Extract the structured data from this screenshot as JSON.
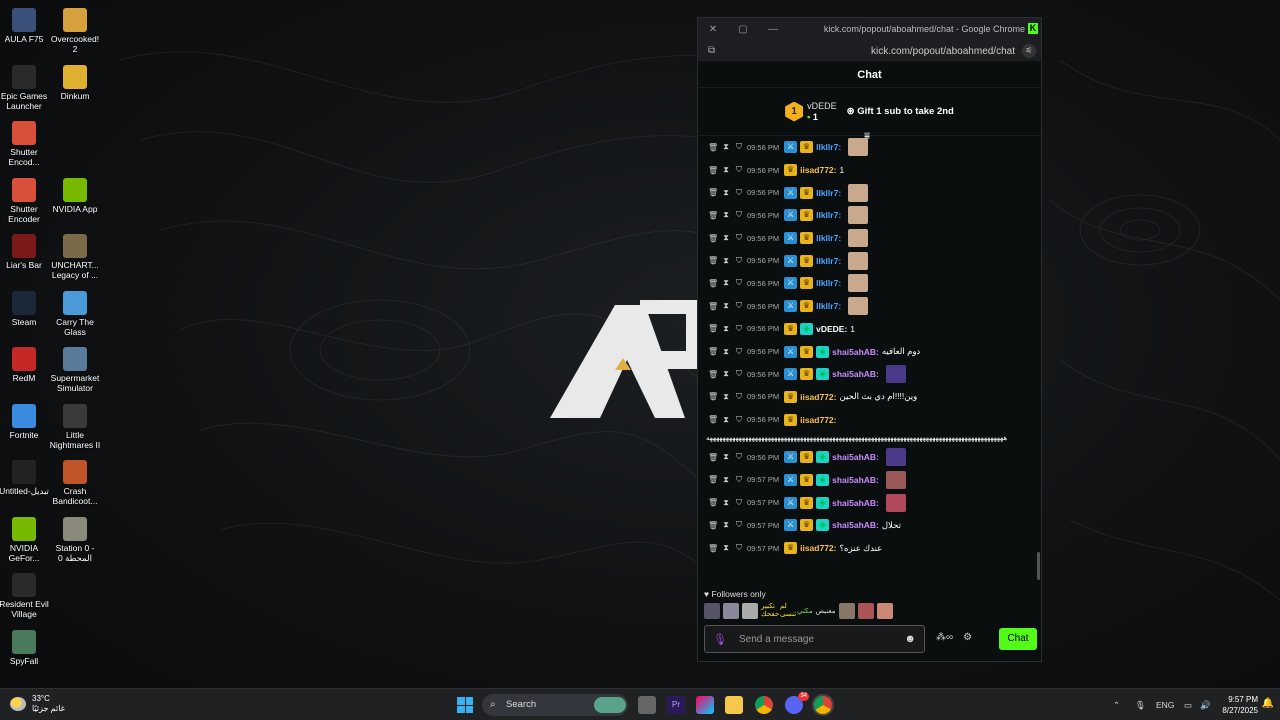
{
  "desktop": {
    "icons": [
      {
        "label": "AULA F75",
        "color": "#3a4f7a"
      },
      {
        "label": "Overcooked! 2",
        "color": "#d6a03c"
      },
      {
        "label": "Epic Games Launcher",
        "color": "#2a2a2a"
      },
      {
        "label": "Dinkum",
        "color": "#e0b030"
      },
      {
        "label": "Shutter Encod...",
        "color": "#d94f3a"
      },
      {
        "label": "Shutter Encoder",
        "color": "#d94f3a"
      },
      {
        "label": "NVIDIA App",
        "color": "#76b900"
      },
      {
        "label": "Liar's Bar",
        "color": "#7a1a1a"
      },
      {
        "label": "UNCHART... Legacy of ...",
        "color": "#7a6a4a"
      },
      {
        "label": "Steam",
        "color": "#1b2838"
      },
      {
        "label": "Carry The Glass",
        "color": "#4a9ad8"
      },
      {
        "label": "RedM",
        "color": "#c62828"
      },
      {
        "label": "Supermarket Simulator",
        "color": "#5a7a9a"
      },
      {
        "label": "Fortnite",
        "color": "#3a8ae0"
      },
      {
        "label": "Little Nightmares II",
        "color": "#3a3a3a"
      },
      {
        "label": "Untitled-تبديل",
        "color": "#222"
      },
      {
        "label": "Crash Bandicoot...",
        "color": "#c0552a"
      },
      {
        "label": "NVIDIA GeFor...",
        "color": "#76b900"
      },
      {
        "label": "Station 0 - المحطة 0",
        "color": "#8a8a7a"
      },
      {
        "label": "Resident Evil Village",
        "color": "#2a2a2a"
      },
      {
        "label": "SpyFall",
        "color": "#4a7a5a"
      }
    ]
  },
  "window": {
    "title": "kick.com/popout/aboahmed/chat - Google Chrome",
    "url": "kick.com/popout/aboahmed/chat",
    "brand": "K"
  },
  "chat": {
    "header": "Chat",
    "leader": {
      "rank": "1",
      "user": "vDEDE",
      "count": "1",
      "gift_text": "Gift 1 sub to take 2nd"
    },
    "messages": [
      {
        "time": "09:56 PM",
        "badges": [
          "mod",
          "crown"
        ],
        "user": "lIkllr7:",
        "color": "#4aa3ff",
        "text": "",
        "emote": "#c9a98e"
      },
      {
        "time": "09:56 PM",
        "badges": [
          "crown"
        ],
        "user": "iisad772:",
        "color": "#f7c04a",
        "text": "1",
        "emote": ""
      },
      {
        "time": "09:56 PM",
        "badges": [
          "mod",
          "crown"
        ],
        "user": "lIkllr7:",
        "color": "#4aa3ff",
        "text": "",
        "emote": "#c9a98e"
      },
      {
        "time": "09:56 PM",
        "badges": [
          "mod",
          "crown"
        ],
        "user": "lIkllr7:",
        "color": "#4aa3ff",
        "text": "",
        "emote": "#c9a98e"
      },
      {
        "time": "09:56 PM",
        "badges": [
          "mod",
          "crown"
        ],
        "user": "lIkllr7:",
        "color": "#4aa3ff",
        "text": "",
        "emote": "#c9a98e"
      },
      {
        "time": "09:56 PM",
        "badges": [
          "mod",
          "crown"
        ],
        "user": "lIkllr7:",
        "color": "#4aa3ff",
        "text": "",
        "emote": "#c9a98e"
      },
      {
        "time": "09:56 PM",
        "badges": [
          "mod",
          "crown"
        ],
        "user": "lIkllr7:",
        "color": "#4aa3ff",
        "text": "",
        "emote": "#c9a98e"
      },
      {
        "time": "09:56 PM",
        "badges": [
          "mod",
          "crown"
        ],
        "user": "lIkllr7:",
        "color": "#4aa3ff",
        "text": "",
        "emote": "#c9a98e"
      },
      {
        "time": "09:56 PM",
        "badges": [
          "crown",
          "sub"
        ],
        "user": "vDEDE:",
        "color": "#ffffff",
        "text": "1",
        "emote": ""
      },
      {
        "time": "09:56 PM",
        "badges": [
          "mod",
          "crown",
          "sub"
        ],
        "user": "shai5ahAB:",
        "color": "#c88cff",
        "text": "دوم العافيه",
        "emote": ""
      },
      {
        "time": "09:56 PM",
        "badges": [
          "mod",
          "crown",
          "sub"
        ],
        "user": "shai5ahAB:",
        "color": "#c88cff",
        "text": "",
        "emote": "#4a3a8a"
      },
      {
        "time": "09:56 PM",
        "badges": [
          "crown"
        ],
        "user": "iisad772:",
        "color": "#f7c04a",
        "text": "وين!!!!ام دي بث الحين",
        "emote": ""
      },
      {
        "time": "09:56 PM",
        "badges": [
          "crown"
        ],
        "user": "iisad772:",
        "color": "#f7c04a",
        "text": "",
        "emote": ""
      }
    ],
    "wrap_text": "ههههههههههههههههههههههههههههههههههههههههههههههههههههههههههههههههههههههههههههههههههههههههههههه",
    "messages2": [
      {
        "time": "09:56 PM",
        "badges": [
          "mod",
          "crown",
          "sub"
        ],
        "user": "shai5ahAB:",
        "color": "#c88cff",
        "text": "",
        "emote": "#4a3a8a"
      },
      {
        "time": "09:57 PM",
        "badges": [
          "mod",
          "crown",
          "sub"
        ],
        "user": "shai5ahAB:",
        "color": "#c88cff",
        "text": "",
        "emote": "#9a5a5a"
      },
      {
        "time": "09:57 PM",
        "badges": [
          "mod",
          "crown",
          "sub"
        ],
        "user": "shai5ahAB:",
        "color": "#c88cff",
        "text": "",
        "emote": "#b04a5a"
      },
      {
        "time": "09:57 PM",
        "badges": [
          "mod",
          "crown",
          "sub"
        ],
        "user": "shai5ahAB:",
        "color": "#c88cff",
        "text": "تحلال",
        "emote": ""
      },
      {
        "time": "09:57 PM",
        "badges": [
          "crown"
        ],
        "user": "iisad772:",
        "color": "#f7c04a",
        "text": "عندك عنزه؟",
        "emote": ""
      }
    ],
    "followers_only": "Followers only",
    "quick_emotes": [
      "تكبير حفحك",
      "لم تنسى",
      "مكتي",
      "معنيص"
    ],
    "placeholder": "Send a message",
    "send_label": "Chat"
  },
  "taskbar": {
    "weather_temp": "33°C",
    "weather_desc": "غائم جزئيًا",
    "search_label": "Search",
    "lang": "ENG",
    "time": "9:57 PM",
    "date": "8/27/2025",
    "discord_badge": "34"
  }
}
